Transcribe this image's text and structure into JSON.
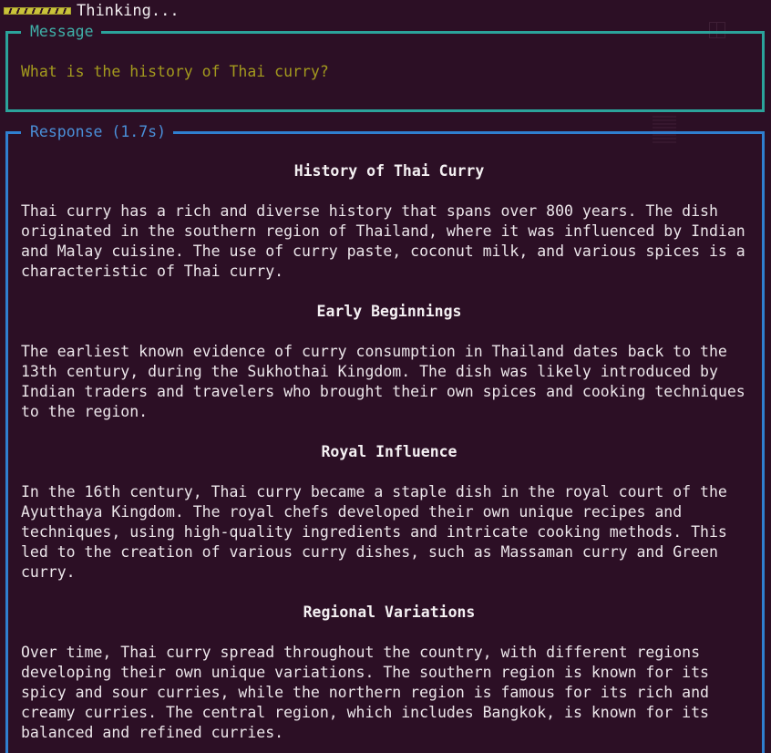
{
  "status": {
    "text": "Thinking..."
  },
  "message_panel": {
    "title": "Message",
    "text": "What is the history of Thai curry?"
  },
  "response_panel": {
    "title": "Response (1.7s)",
    "sections": [
      {
        "heading": "History of Thai Curry",
        "paragraph": "Thai curry has a rich and diverse history that spans over 800 years. The dish\noriginated in the southern region of Thailand, where it was influenced by Indian\nand Malay cuisine. The use of curry paste, coconut milk, and various spices is a\ncharacteristic of Thai curry."
      },
      {
        "heading": "Early Beginnings",
        "paragraph": "The earliest known evidence of curry consumption in Thailand dates back to the\n13th century, during the Sukhothai Kingdom. The dish was likely introduced by\nIndian traders and travelers who brought their own spices and cooking techniques\nto the region."
      },
      {
        "heading": "Royal Influence",
        "paragraph": "In the 16th century, Thai curry became a staple dish in the royal court of the\nAyutthaya Kingdom. The royal chefs developed their own unique recipes and\ntechniques, using high-quality ingredients and intricate cooking methods. This\nled to the creation of various curry dishes, such as Massaman curry and Green\ncurry."
      },
      {
        "heading": "Regional Variations",
        "paragraph": "Over time, Thai curry spread throughout the country, with different regions\ndeveloping their own unique variations. The southern region is known for its\nspicy and sour curries, while the northern region is famous for its rich and\ncreamy curries. The central region, which includes Bangkok, is known for its\nbalanced and refined curries."
      }
    ]
  },
  "colors": {
    "background": "#2c0f25",
    "message_border": "#2ba39b",
    "response_border": "#2f7fd0",
    "message_text": "#a39a1e",
    "spinner": "#c9c33a"
  },
  "icons": {
    "status_spinner": "progress-spinner-icon",
    "corner": "split-window-icon"
  }
}
